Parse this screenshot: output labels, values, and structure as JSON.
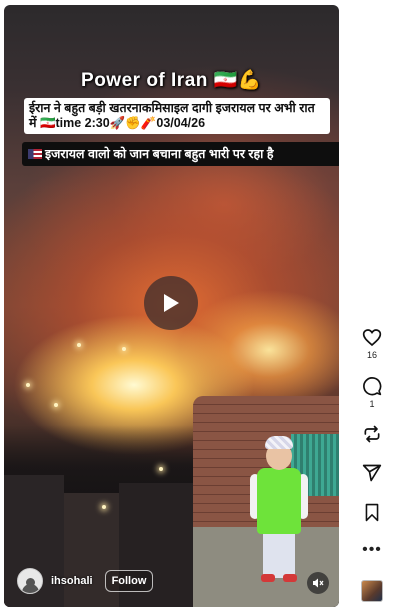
{
  "video": {
    "title": "Power of Iran 🇮🇷💪",
    "caption_line1": "ईरान ने बहुत बड़ी खतरनाकमिसाइल दागी इजरायल पर अभी रात में 🇮🇷time 2:30🚀✊🧨03/04/26",
    "caption_line2": "इजरायल वालो को जान बचाना बहुत भारी  पर रहा है"
  },
  "author": {
    "username": "ihsohali",
    "follow_label": "Follow"
  },
  "actions": {
    "likes": "16",
    "comments": "1"
  },
  "icons": {
    "play": "play-icon",
    "mute": "mute-icon",
    "like": "heart-icon",
    "comment": "comment-icon",
    "repost": "repost-icon",
    "share": "share-icon",
    "save": "bookmark-icon",
    "more": "more-icon"
  },
  "colors": {
    "follow_border": "#ffffff",
    "caption_bg_light": "#ffffff",
    "caption_bg_dark": "#0e0e0e"
  }
}
